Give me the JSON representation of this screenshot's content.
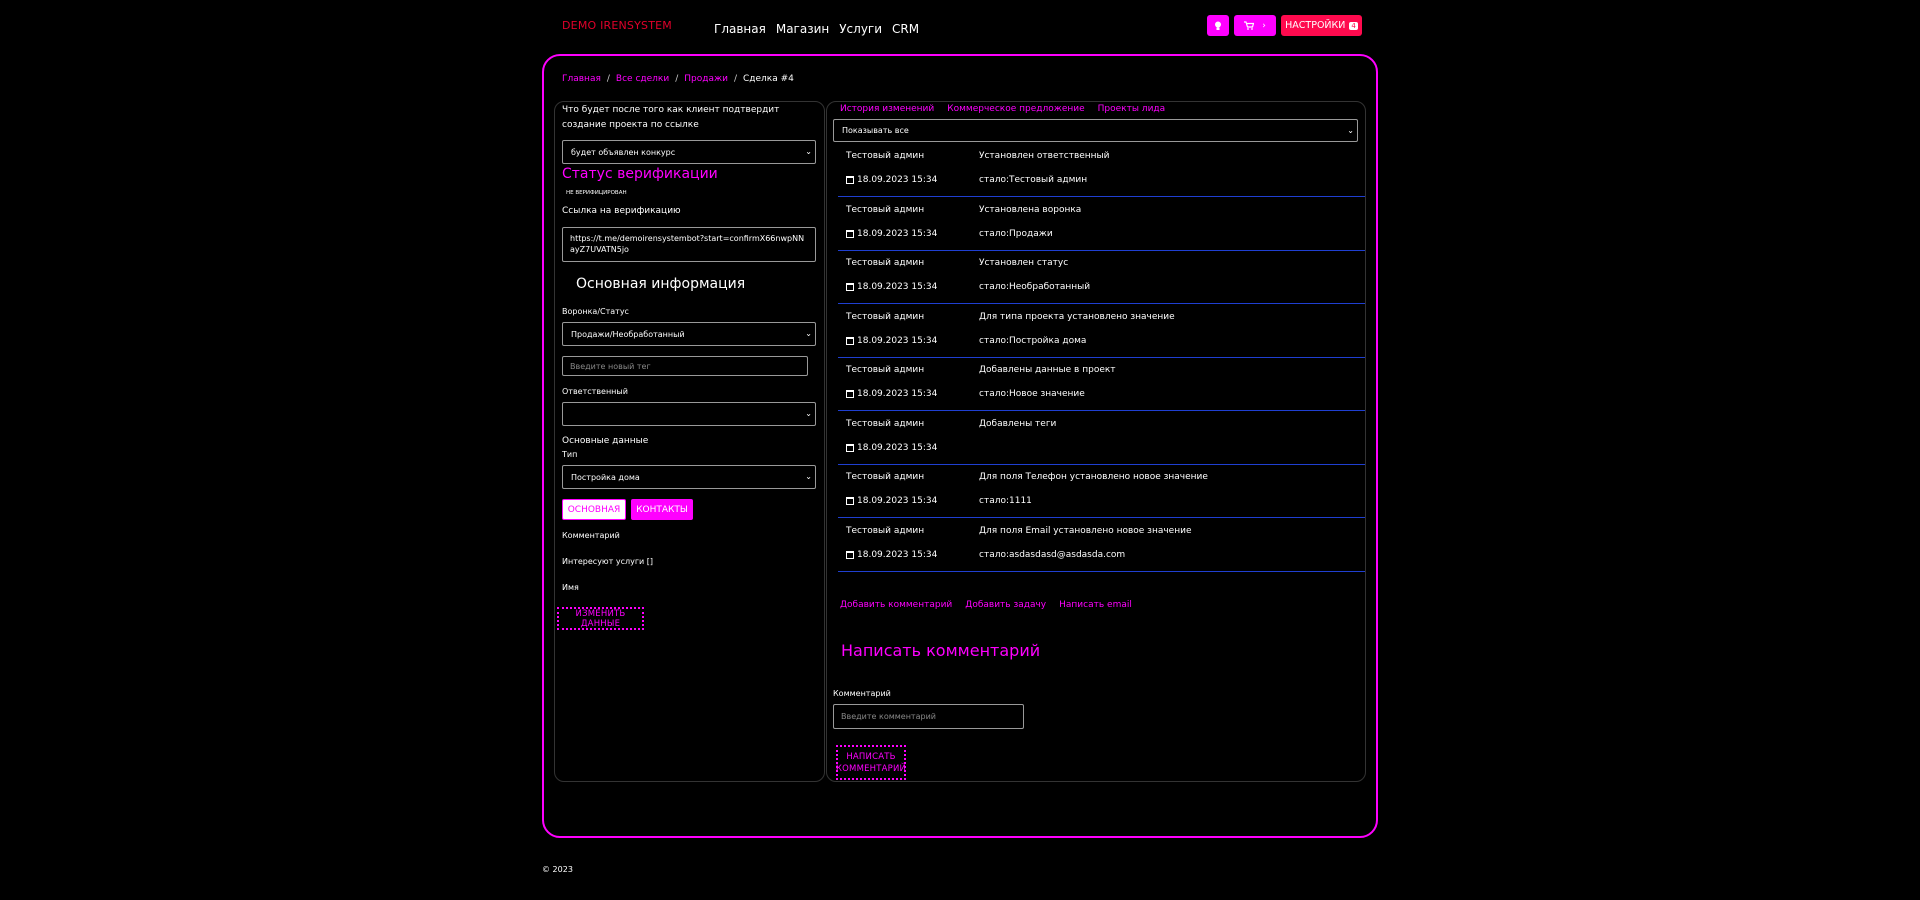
{
  "header": {
    "logo": "DEMO IRENSYSTEM",
    "nav": [
      "Главная",
      "Магазин",
      "Услуги",
      "CRM"
    ],
    "settings_label": "НАСТРОЙКИ",
    "settings_badge": "4",
    "cart_arrow": "›"
  },
  "breadcrumb": {
    "items": [
      "Главная",
      "Все сделки",
      "Продажи"
    ],
    "current": "Сделка #4"
  },
  "left": {
    "question": "Что будет после того как клиент подтвердит создание проекта по ссылке",
    "question_select": "будет объявлен конкурс",
    "verif_title": "Статус верификации",
    "verif_badge": "НЕ ВЕРИФИЦИРОВАН",
    "verif_link_label": "Ссылка на верификацию",
    "verif_link": "https://t.me/demoirensystembot?start=confirmX66nwpNNayZ7UVATN5jo",
    "main_info_title": "Основная информация",
    "funnel_label": "Воронка/Статус",
    "funnel_value": "Продажи/Необработанный",
    "tag_placeholder": "Введите новый тег",
    "responsible_label": "Ответственный",
    "responsible_value": "",
    "main_data_label": "Основные данные",
    "type_label": "Тип",
    "type_value": "Постройка дома",
    "tab_main": "ОСНОВНАЯ",
    "tab_contacts": "КОНТАКТЫ",
    "comment_label": "Комментарий",
    "services_label": "Интересуют услуги []",
    "name_label": "Имя",
    "edit_button": "ИЗМЕНИТЬ ДАННЫЕ"
  },
  "right": {
    "tabs": [
      "История изменений",
      "Коммерческое предложение",
      "Проекты лида"
    ],
    "filter_value": "Показывать все",
    "history": [
      {
        "who": "Тестовый админ",
        "what": "Установлен ответственный",
        "date": "18.09.2023 15:34",
        "value": "стало:Тестовый админ"
      },
      {
        "who": "Тестовый админ",
        "what": "Установлена воронка",
        "date": "18.09.2023 15:34",
        "value": "стало:Продажи"
      },
      {
        "who": "Тестовый админ",
        "what": "Установлен статус",
        "date": "18.09.2023 15:34",
        "value": "стало:Необработанный"
      },
      {
        "who": "Тестовый админ",
        "what": "Для типа проекта установлено значение",
        "date": "18.09.2023 15:34",
        "value": "стало:Постройка дома"
      },
      {
        "who": "Тестовый админ",
        "what": "Добавлены данные в проект",
        "date": "18.09.2023 15:34",
        "value": "стало:Новое значение"
      },
      {
        "who": "Тестовый админ",
        "what": "Добавлены теги",
        "date": "18.09.2023 15:34",
        "value": ""
      },
      {
        "who": "Тестовый админ",
        "what": "Для поля Телефон установлено новое значение",
        "date": "18.09.2023 15:34",
        "value": "стало:1111"
      },
      {
        "who": "Тестовый админ",
        "what": "Для поля Email установлено новое значение",
        "date": "18.09.2023 15:34",
        "value": "стало:asdasdasd@asdasda.com"
      }
    ],
    "actions": [
      "Добавить комментарий",
      "Добавить задачу",
      "Написать email"
    ],
    "comment_title": "Написать комментарий",
    "comment_label": "Комментарий",
    "comment_placeholder": "Введите комментарий",
    "comment_button": "НАПИСАТЬ КОММЕНТАРИЙ"
  },
  "footer": "© 2023",
  "colors": {
    "accent": "#ff00ff",
    "danger": "#ff0a4e",
    "divider": "#1f3fd1"
  },
  "icons": [
    "bulb-icon",
    "cart-icon",
    "calendar-icon",
    "chevron-down-icon"
  ]
}
